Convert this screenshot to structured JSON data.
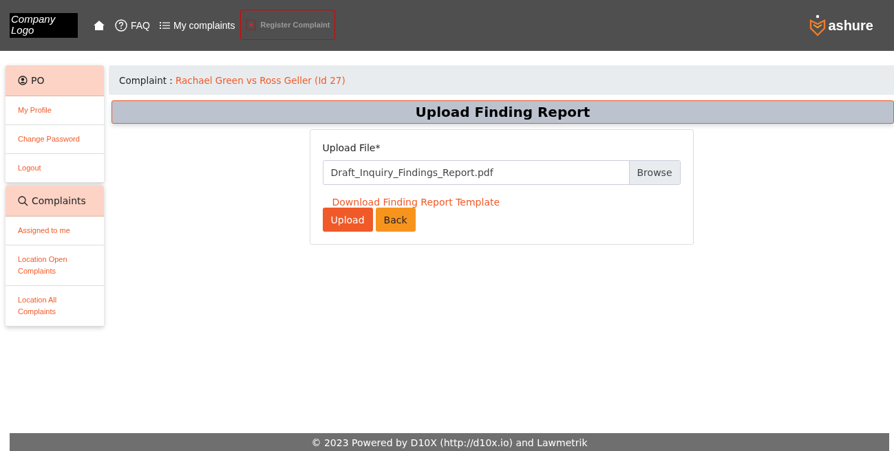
{
  "header": {
    "logo_text": "Company Logo",
    "nav": [
      {
        "kind": "home"
      },
      {
        "kind": "faq",
        "label": "FAQ"
      },
      {
        "kind": "list",
        "label": "My complaints"
      },
      {
        "kind": "image",
        "label": "Register Complaint"
      }
    ],
    "brand": "ashure"
  },
  "sidebar": [
    {
      "kind": "user",
      "title": "PO",
      "items": [
        "My Profile",
        "Change Password",
        "Logout"
      ]
    },
    {
      "kind": "search",
      "title": "Complaints",
      "items": [
        "Assigned to me",
        "Location Open Complaints",
        "Location All Complaints"
      ]
    }
  ],
  "breadcrumb": {
    "label": "Complaint :",
    "link": "Rachael Green vs Ross Geller (Id 27)"
  },
  "page_title": "Upload Finding Report",
  "form": {
    "label": "Upload File*",
    "value": "Draft_Inquiry_Findings_Report.pdf",
    "browse": "Browse",
    "template_link": "Download Finding Report Template",
    "buttons": [
      {
        "kind": "primary",
        "label": "Upload"
      },
      {
        "kind": "secondary",
        "label": "Back"
      }
    ]
  },
  "footer": "© 2023 Powered by D10X (http://d10x.io) and Lawmetrik"
}
